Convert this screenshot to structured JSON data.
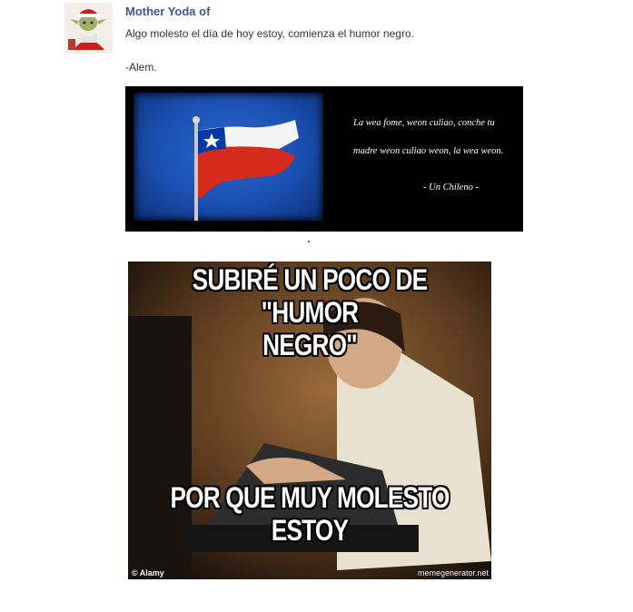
{
  "post": {
    "author": "Mother Yoda of",
    "line1": "Algo molesto el día de hoy estoy, comienza el humor negro.",
    "line2": "-Alem."
  },
  "banner": {
    "quote_line1": "La wea fome, weon culiao, conche tu",
    "quote_line2": "madre weon culiao weon, la wea weon.",
    "quote_author": "- Un Chileno -"
  },
  "meme": {
    "top_text_line1": "SUBIRÉ UN POCO DE \"HUMOR",
    "top_text_line2": "NEGRO\"",
    "bottom_text_line1": "POR QUE MUY MOLESTO",
    "bottom_text_line2": "ESTOY",
    "watermark_left": "© Alamy",
    "watermark_right": "memegenerator.net"
  },
  "colors": {
    "author_link": "#3b5998",
    "flag_red": "#d52b1e",
    "flag_blue": "#0039a6"
  }
}
